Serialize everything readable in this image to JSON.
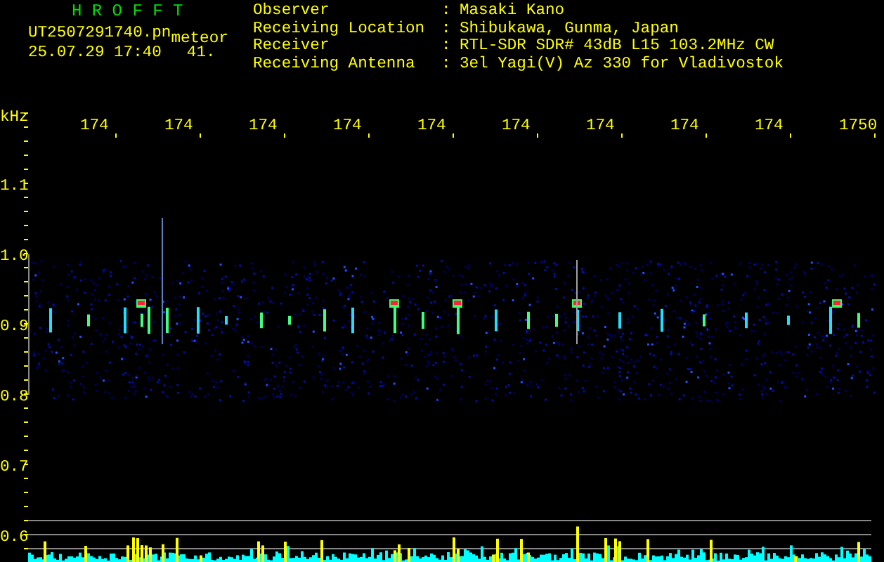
{
  "header": {
    "title": "H R O F F T",
    "file_name": "UT2507291740.pn",
    "file_tag": "meteor",
    "datetime": "25.07.29 17:40",
    "value": "41."
  },
  "info": [
    {
      "label": "Observer",
      "separator": ":",
      "value": "Masaki Kano"
    },
    {
      "label": "Receiving Location",
      "separator": ":",
      "value": "Shibukawa, Gunma, Japan"
    },
    {
      "label": "Receiver",
      "separator": ":",
      "value": "RTL-SDR SDR# 43dB L15 103.2MHz CW"
    },
    {
      "label": "Receiving Antenna",
      "separator": ":",
      "value": "3el Yagi(V) Az 330 for Vladivostok"
    }
  ],
  "time_axis": {
    "labels": [
      "174",
      "174",
      "174",
      "174",
      "174",
      "174",
      "174",
      "174",
      "174",
      "1750"
    ]
  },
  "freq_axis": {
    "unit": "kHz",
    "labels": [
      "1.1",
      "1.0",
      "0.9",
      "0.8",
      "0.7",
      "0.6"
    ]
  }
}
